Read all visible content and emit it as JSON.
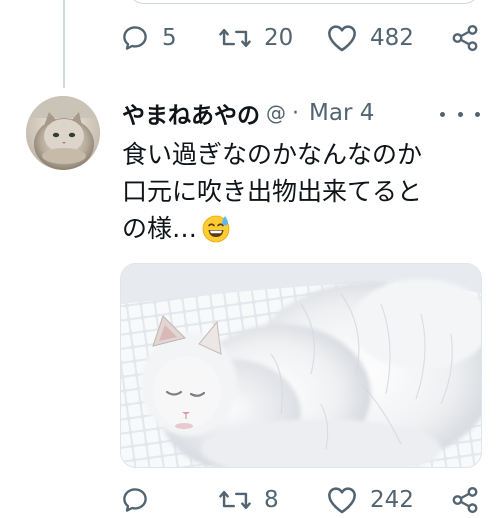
{
  "prev_tweet": {
    "actions": {
      "reply_count": "5",
      "retweet_count": "20",
      "like_count": "482"
    }
  },
  "tweet": {
    "display_name": "やまねあやの",
    "handle_fragment": "@",
    "separator": "·",
    "date": "Mar 4",
    "text_lines": [
      "食い過ぎなのかなんなのか",
      "口元に吹き出物出来てると",
      "の様…"
    ],
    "emoji": "sweat-smile-emoji",
    "media": "white-fluffy-cat-sleeping-in-basket",
    "actions": {
      "reply_count": "",
      "retweet_count": "8",
      "like_count": "242"
    }
  },
  "colors": {
    "text_primary": "#0f1419",
    "text_secondary": "#536471",
    "border": "#cfd9de"
  }
}
